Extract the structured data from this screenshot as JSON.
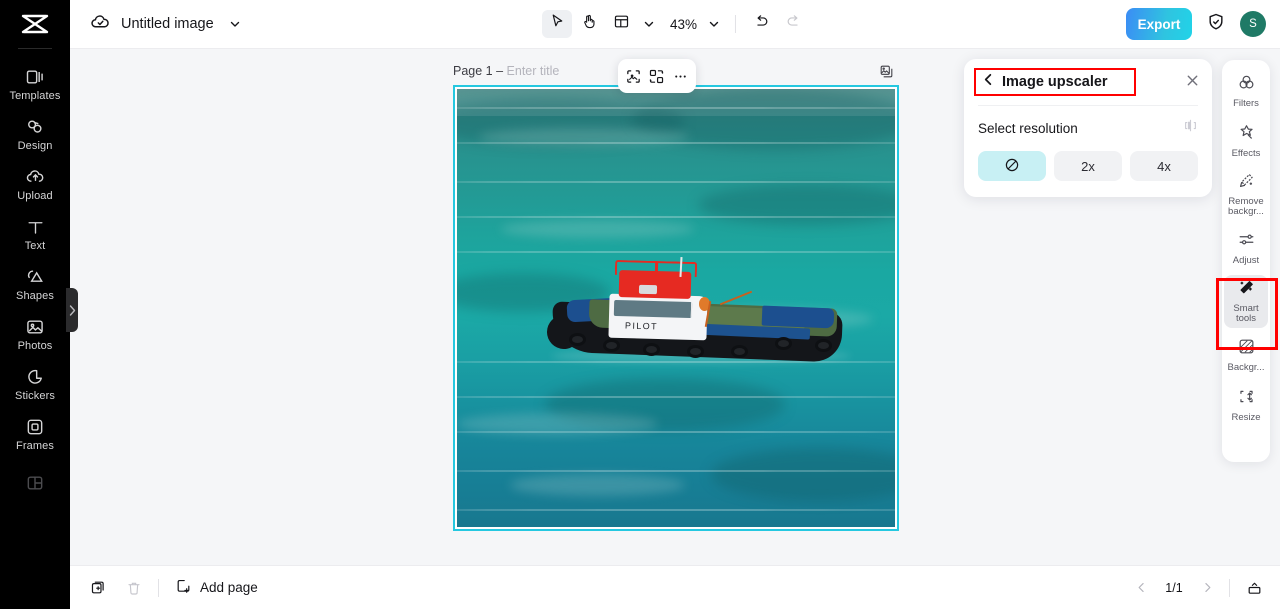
{
  "app": {
    "logo": "capcut-logo"
  },
  "sidebar": {
    "items": [
      {
        "label": "Templates",
        "icon": "templates-icon"
      },
      {
        "label": "Design",
        "icon": "design-icon"
      },
      {
        "label": "Upload",
        "icon": "upload-cloud-icon"
      },
      {
        "label": "Text",
        "icon": "text-icon"
      },
      {
        "label": "Shapes",
        "icon": "shapes-icon"
      },
      {
        "label": "Photos",
        "icon": "photos-icon"
      },
      {
        "label": "Stickers",
        "icon": "stickers-icon"
      },
      {
        "label": "Frames",
        "icon": "frames-icon"
      },
      {
        "label": "",
        "icon": "layouts-icon"
      }
    ],
    "collapse_handle": "collapse-chevron-icon"
  },
  "topbar": {
    "cloud_icon": "cloud-saved-icon",
    "doc_title": "Untitled image",
    "title_chevron": "chevron-down-icon",
    "tools": [
      {
        "name": "select-tool",
        "icon": "cursor-icon",
        "active": true
      },
      {
        "name": "hand-tool",
        "icon": "hand-icon",
        "active": false
      },
      {
        "name": "layout-tool",
        "icon": "layout-icon",
        "active": false
      }
    ],
    "zoom_value": "43%",
    "undo_icon": "undo-icon",
    "redo_icon": "redo-icon",
    "export_label": "Export",
    "shield_icon": "shield-check-icon",
    "avatar_initial": "S",
    "avatar_color": "#1f7a66"
  },
  "canvas": {
    "page_label": "Page 1 –",
    "title_placeholder": "Enter title",
    "duplicate_page_icon": "duplicate-image-icon",
    "selection_color": "#25c8e0",
    "float_toolbar": [
      {
        "name": "crop-image-button",
        "icon": "crop-image-icon"
      },
      {
        "name": "replace-image-button",
        "icon": "replace-image-icon"
      },
      {
        "name": "more-options-button",
        "icon": "more-horizontal-icon"
      }
    ],
    "image_text": "PILOT"
  },
  "panel": {
    "back_icon": "chevron-left-icon",
    "title": "Image upscaler",
    "close_icon": "close-icon",
    "section_label": "Select resolution",
    "compare_icon": "compare-before-after-icon",
    "resolutions": [
      {
        "label": "",
        "icon": "none-forbidden-icon",
        "selected": true
      },
      {
        "label": "2x",
        "icon": "",
        "selected": false
      },
      {
        "label": "4x",
        "icon": "",
        "selected": false
      }
    ],
    "highlight_color": "#ff0000",
    "selected_bg": "#c8f0f4"
  },
  "right_rail": {
    "items": [
      {
        "label": "Filters",
        "icon": "filters-icon",
        "active": false
      },
      {
        "label": "Effects",
        "icon": "effects-icon",
        "active": false
      },
      {
        "label": "Remove backgr...",
        "icon": "remove-background-icon",
        "active": false
      },
      {
        "label": "Adjust",
        "icon": "adjust-icon",
        "active": false
      },
      {
        "label": "Smart tools",
        "icon": "smart-tools-icon",
        "active": true
      },
      {
        "label": "Backgr...",
        "icon": "background-icon",
        "active": false
      },
      {
        "label": "Resize",
        "icon": "resize-icon",
        "active": false
      }
    ]
  },
  "bottombar": {
    "duplicate_icon": "duplicate-page-icon",
    "delete_icon": "trash-icon",
    "add_page_icon": "add-page-icon",
    "add_page_label": "Add page",
    "prev_icon": "chevron-left-icon",
    "page_indicator": "1/1",
    "next_icon": "chevron-right-icon",
    "present_icon": "present-icon"
  }
}
